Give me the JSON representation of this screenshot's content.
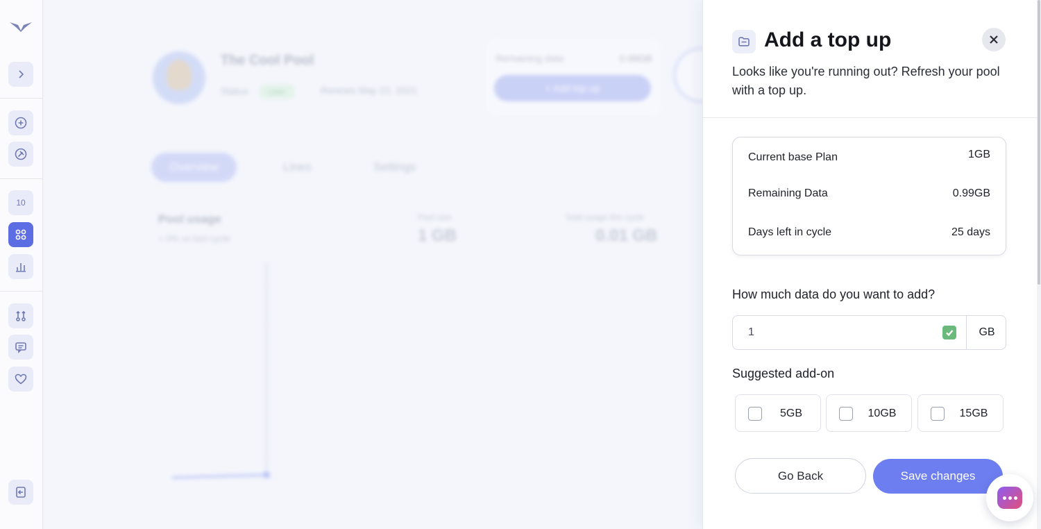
{
  "sidebar": {
    "items": [
      {
        "name": "expand-button",
        "icon": "chevron-right-icon"
      },
      {
        "name": "add-button",
        "icon": "plus-circle-icon"
      },
      {
        "name": "explore-button",
        "icon": "compass-icon"
      },
      {
        "name": "ten-button",
        "label": "10"
      },
      {
        "name": "dashboard-button",
        "icon": "grid-icon",
        "active": true
      },
      {
        "name": "stats-button",
        "icon": "bar-chart-icon"
      },
      {
        "name": "routes-button",
        "icon": "route-icon"
      },
      {
        "name": "messages-button",
        "icon": "chat-icon"
      },
      {
        "name": "favorites-button",
        "icon": "heart-icon"
      },
      {
        "name": "logout-button",
        "icon": "logout-icon"
      }
    ]
  },
  "background": {
    "pool_name": "The Cool Pool",
    "status_label": "Status",
    "status_value": "Live",
    "renews": "Renews May 22, 2021",
    "remaining_label": "Remaining data",
    "remaining_value": "0.99GB",
    "add_topup_label": "+ Add top up",
    "tabs": [
      "Overview",
      "Lines",
      "Settings"
    ],
    "usage_title": "Pool usage",
    "usage_sub": "+ 0% vs last cycle",
    "pool_size_label": "Pool size",
    "pool_size_value": "1 GB",
    "total_usage_label": "Total usage this cycle",
    "total_usage_value": "0.01 GB"
  },
  "panel": {
    "title": "Add a top up",
    "subtitle": "Looks like you're running out? Refresh your pool with a top up.",
    "summary": [
      {
        "label": "Current base Plan",
        "value": "1GB"
      },
      {
        "label": "Remaining Data",
        "value": "0.99GB"
      },
      {
        "label": "Days left in cycle",
        "value": "25 days"
      }
    ],
    "question": "How much data do you want to add?",
    "amount_value": "1",
    "amount_unit": "GB",
    "suggested_label": "Suggested add-on",
    "addons": [
      "5GB",
      "10GB",
      "15GB"
    ],
    "back_label": "Go Back",
    "save_label": "Save changes"
  },
  "colors": {
    "accent": "#6d7ef0",
    "active_sidebar": "#5d6de4",
    "valid_green": "#6cb97c"
  }
}
